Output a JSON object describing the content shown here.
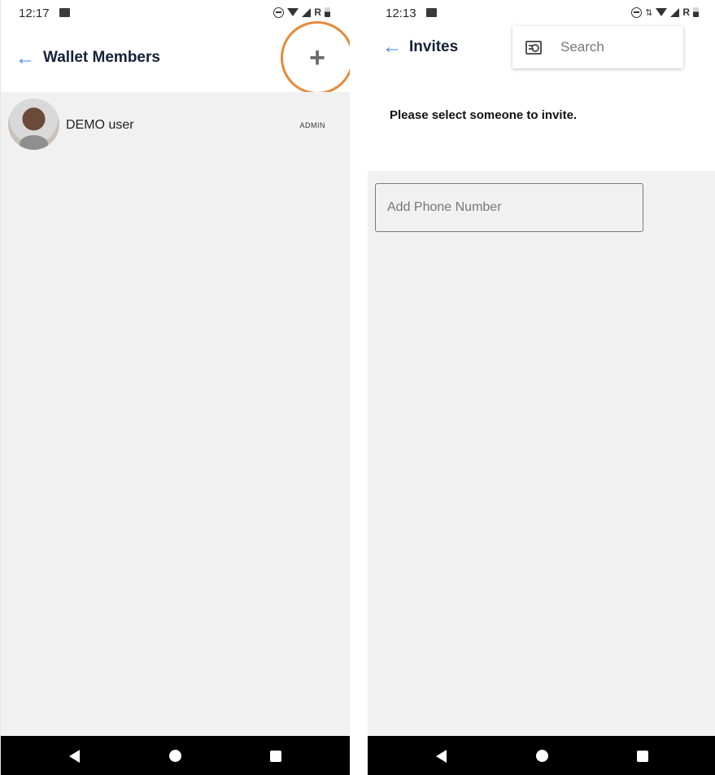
{
  "left_screen": {
    "status_time": "12:17",
    "roaming": "R",
    "title": "Wallet Members",
    "add_button": "+",
    "member": {
      "name": "DEMO user",
      "role": "ADMIN"
    }
  },
  "right_screen": {
    "status_time": "12:13",
    "roaming": "R",
    "title": "Invites",
    "search": {
      "placeholder": "Search"
    },
    "prompt": "Please select someone to invite.",
    "phone_input": {
      "placeholder": "Add Phone Number",
      "value": ""
    }
  },
  "icons": {
    "back": "arrow-left-icon",
    "add": "plus-icon",
    "search": "search-list-icon",
    "nav_back": "nav-back-icon",
    "nav_home": "nav-home-icon",
    "nav_recents": "nav-recents-icon"
  },
  "colors": {
    "accent_blue": "#3b82f6",
    "highlight_circle": "#e58a3a",
    "content_bg": "#f1f1f1",
    "navbar": "#000000"
  }
}
